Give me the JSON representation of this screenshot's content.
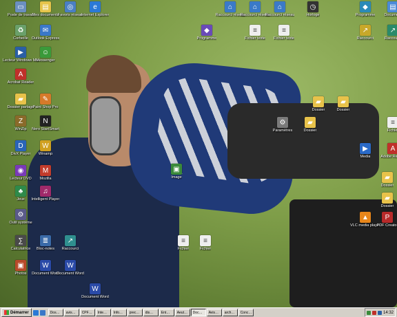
{
  "icons": [
    {
      "label": "Poste de travail",
      "glyph": "▭",
      "color": "#6b8fbf"
    },
    {
      "label": "Mes documents",
      "glyph": "▤",
      "color": "#e6c44a"
    },
    {
      "label": "Favoris réseau",
      "glyph": "◎",
      "color": "#4a7fc4"
    },
    {
      "label": "Internet Explorer",
      "glyph": "e",
      "color": "#2b79d6"
    },
    {
      "label": "Corbeille",
      "glyph": "♻",
      "color": "#6aa06a"
    },
    {
      "label": "Outlook Express",
      "glyph": "✉",
      "color": "#3a78c8"
    },
    {
      "label": "Lecteur Windows Media",
      "glyph": "▶",
      "color": "#2a5fa5"
    },
    {
      "label": "Messenger",
      "glyph": "☺",
      "color": "#3a9a3a"
    },
    {
      "label": "Acrobat Reader",
      "glyph": "A",
      "color": "#c0302a"
    },
    {
      "label": "Dossier partagé",
      "glyph": "▰",
      "color": "#e8c24a"
    },
    {
      "label": "Paint Shop Pro",
      "glyph": "✎",
      "color": "#d67a2a"
    },
    {
      "label": "WinZip",
      "glyph": "Z",
      "color": "#8a6a2a"
    },
    {
      "label": "Nero StartSmart",
      "glyph": "N",
      "color": "#222222"
    },
    {
      "label": "DivX Player",
      "glyph": "D",
      "color": "#2a64b8"
    },
    {
      "label": "Winamp",
      "glyph": "W",
      "color": "#d0a020"
    },
    {
      "label": "Lecteur DVD",
      "glyph": "◉",
      "color": "#7a3ab8"
    },
    {
      "label": "Mozilla",
      "glyph": "M",
      "color": "#c23c2c"
    },
    {
      "label": "Jeux",
      "glyph": "♣",
      "color": "#2e8a4a"
    },
    {
      "label": "Intelligent Player",
      "glyph": "♫",
      "color": "#a02a6a"
    },
    {
      "label": "Outil système",
      "glyph": "⚙",
      "color": "#5a5a8a"
    },
    {
      "label": "Calculatrice",
      "glyph": "∑",
      "color": "#4a4a4a"
    },
    {
      "label": "Bloc-notes",
      "glyph": "≣",
      "color": "#3a6aa8"
    },
    {
      "label": "Raccourci",
      "glyph": "↗",
      "color": "#2f8f8f"
    },
    {
      "label": "Photos",
      "glyph": "▣",
      "color": "#b84a2a"
    },
    {
      "label": "Document Word",
      "glyph": "W",
      "color": "#2a4aa8"
    },
    {
      "label": "Document Word",
      "glyph": "W",
      "color": "#2a4aa8"
    },
    {
      "label": "Document Word",
      "glyph": "W",
      "color": "#2a4aa8"
    },
    {
      "label": "Image",
      "glyph": "▣",
      "color": "#3a8a3a"
    },
    {
      "label": "Fichier",
      "glyph": "≡",
      "color": "#eeeeee"
    },
    {
      "label": "Fichier",
      "glyph": "≡",
      "color": "#eeeeee"
    },
    {
      "label": "Dossier",
      "glyph": "▰",
      "color": "#e8c24a"
    },
    {
      "label": "Dossier",
      "glyph": "▰",
      "color": "#e8c24a"
    },
    {
      "label": "Dossier",
      "glyph": "▰",
      "color": "#e8c24a"
    },
    {
      "label": "Dossier",
      "glyph": "▰",
      "color": "#e8c24a"
    },
    {
      "label": "VLC media player",
      "glyph": "▲",
      "color": "#e8861a"
    },
    {
      "label": "PDF Creator",
      "glyph": "P",
      "color": "#b82a2a"
    },
    {
      "label": "Raccourci réseau",
      "glyph": "⌂",
      "color": "#3a7ac8"
    },
    {
      "label": "Raccourci réseau",
      "glyph": "⌂",
      "color": "#3a7ac8"
    },
    {
      "label": "Raccourci réseau",
      "glyph": "⌂",
      "color": "#3a7ac8"
    },
    {
      "label": "Horloge",
      "glyph": "◷",
      "color": "#333333"
    },
    {
      "label": "Fichier texte",
      "glyph": "≡",
      "color": "#eeeeee"
    },
    {
      "label": "Fichier texte",
      "glyph": "≡",
      "color": "#eeeeee"
    },
    {
      "label": "Programme",
      "glyph": "◆",
      "color": "#6a4ab8"
    },
    {
      "label": "Programme",
      "glyph": "◆",
      "color": "#2a8ab8"
    },
    {
      "label": "Document",
      "glyph": "▤",
      "color": "#4a8ad8"
    },
    {
      "label": "Raccourci",
      "glyph": "↗",
      "color": "#c8a82a"
    },
    {
      "label": "Raccourci",
      "glyph": "↗",
      "color": "#2a8a6a"
    },
    {
      "label": "Paramètres",
      "glyph": "⚙",
      "color": "#7a7a7a"
    },
    {
      "label": "Dossier",
      "glyph": "▰",
      "color": "#e8c24a"
    },
    {
      "label": "Media",
      "glyph": "▶",
      "color": "#2a6ac8"
    },
    {
      "label": "Adobe Reader",
      "glyph": "A",
      "color": "#c0302a"
    },
    {
      "label": "Fichier",
      "glyph": "≡",
      "color": "#eeeeee"
    }
  ],
  "taskbar": {
    "start_label": "Démarrer",
    "tasks": [
      "Dos…",
      "avis…",
      "CPF…",
      "Inte…",
      "Info…",
      "prec…",
      "dis…",
      "Ent…",
      "Aeut…",
      "Doc…",
      "Avis…",
      "arch…",
      "Conc…"
    ],
    "active_task": 9,
    "clock": "14:32"
  }
}
